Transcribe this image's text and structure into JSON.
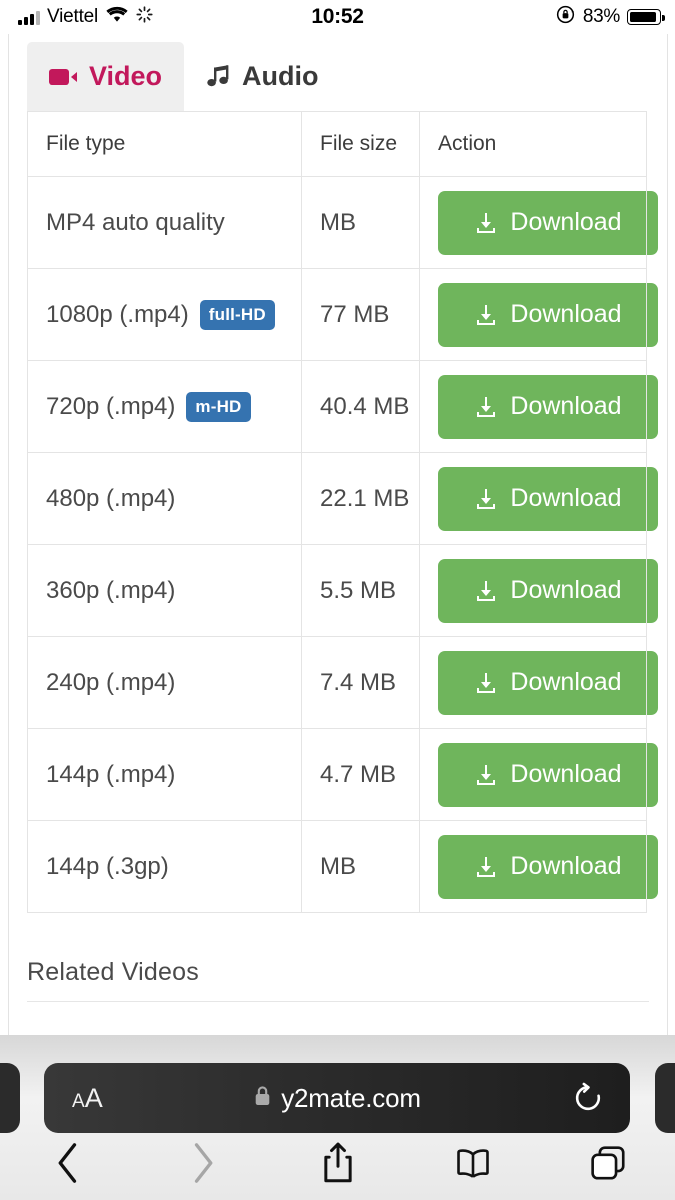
{
  "status_bar": {
    "carrier": "Viettel",
    "time": "10:52",
    "battery_percent": "83%",
    "signal_icon": "cellular-signal-icon",
    "wifi_icon": "wifi-icon",
    "activity_icon": "activity-spinner-icon",
    "rotation_lock_icon": "rotation-lock-icon",
    "battery_icon": "battery-icon"
  },
  "tabs": [
    {
      "label": "Video",
      "icon": "video-camera-icon",
      "active": true
    },
    {
      "label": "Audio",
      "icon": "music-note-icon",
      "active": false
    }
  ],
  "table": {
    "headers": [
      "File type",
      "File size",
      "Action"
    ],
    "rows": [
      {
        "type": "MP4 auto quality",
        "badge": "",
        "size": "MB",
        "action": "Download"
      },
      {
        "type": "1080p (.mp4)",
        "badge": "full-HD",
        "size": "77 MB",
        "action": "Download"
      },
      {
        "type": "720p (.mp4)",
        "badge": "m-HD",
        "size": "40.4 MB",
        "action": "Download"
      },
      {
        "type": "480p (.mp4)",
        "badge": "",
        "size": "22.1 MB",
        "action": "Download"
      },
      {
        "type": "360p (.mp4)",
        "badge": "",
        "size": "5.5 MB",
        "action": "Download"
      },
      {
        "type": "240p (.mp4)",
        "badge": "",
        "size": "7.4 MB",
        "action": "Download"
      },
      {
        "type": "144p (.mp4)",
        "badge": "",
        "size": "4.7 MB",
        "action": "Download"
      },
      {
        "type": "144p (.3gp)",
        "badge": "",
        "size": "MB",
        "action": "Download"
      }
    ]
  },
  "related": {
    "title": "Related Videos"
  },
  "browser": {
    "text_size_small": "A",
    "text_size_large": "A",
    "lock_icon": "lock-icon",
    "url": "y2mate.com",
    "reload_icon": "reload-icon",
    "toolbar": [
      {
        "icon": "back-icon"
      },
      {
        "icon": "forward-icon"
      },
      {
        "icon": "share-icon"
      },
      {
        "icon": "bookmarks-icon"
      },
      {
        "icon": "tabs-icon"
      }
    ]
  },
  "colors": {
    "accent_tab": "#c2185b",
    "badge_blue": "#3573b0",
    "download_green": "#6fb55c",
    "page_text": "#4a4a4a"
  }
}
